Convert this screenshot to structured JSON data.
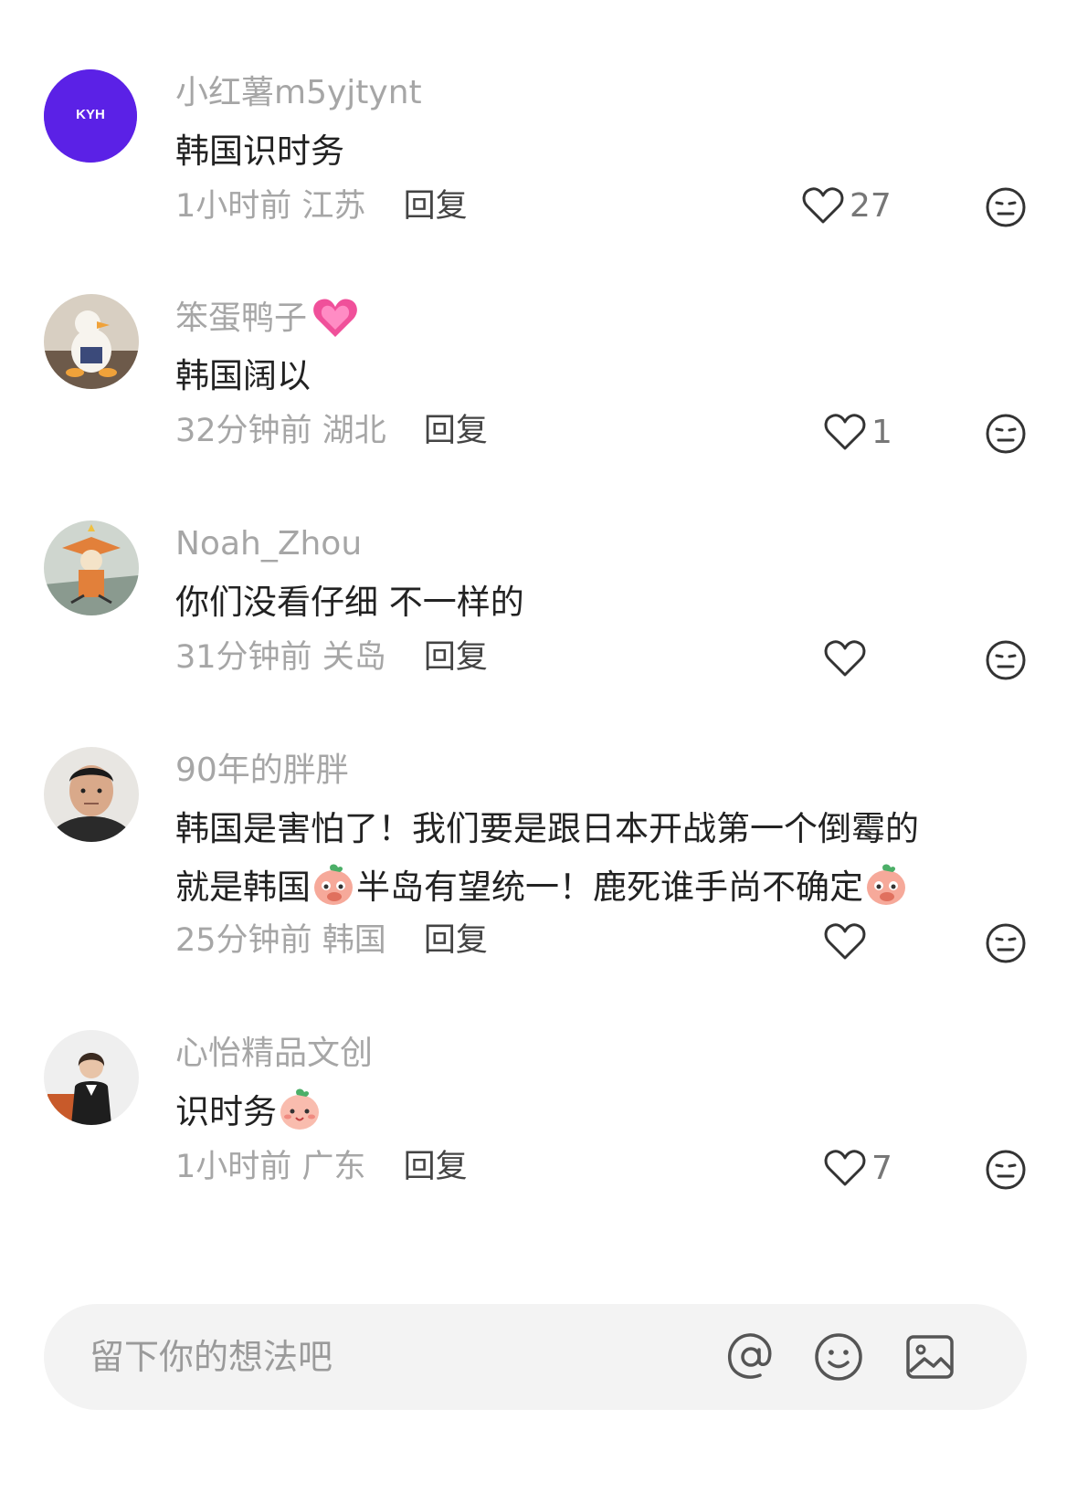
{
  "comments": [
    {
      "username": "小红薯m5yjtynt",
      "avatar_text": "KYH",
      "avatar_color": "#5b21e6",
      "text": "韩国识时务",
      "time": "1小时前",
      "location": "江苏",
      "reply": "回复",
      "likes": "27"
    },
    {
      "username": "笨蛋鸭子",
      "username_emoji": "pink-heart-emoji",
      "text": "韩国阔以",
      "time": "32分钟前",
      "location": "湖北",
      "reply": "回复",
      "likes": "1"
    },
    {
      "username": "Noah_Zhou",
      "text": "你们没看仔细 不一样的",
      "time": "31分钟前",
      "location": "关岛",
      "reply": "回复",
      "likes": ""
    },
    {
      "username": "90年的胖胖",
      "text_line1": "韩国是害怕了！我们要是跟日本开战第一个倒霉的",
      "text_line2_a": "就是韩国",
      "text_line2_b": "半岛有望统一！鹿死谁手尚不确定",
      "inline_emoji": "peach-shy-emoji",
      "time": "25分钟前",
      "location": "韩国",
      "reply": "回复",
      "likes": ""
    },
    {
      "username": "心怡精品文创",
      "text": "识时务",
      "inline_emoji": "peach-smile-emoji",
      "time": "1小时前",
      "location": "广东",
      "reply": "回复",
      "likes": "7"
    }
  ],
  "input": {
    "placeholder": "留下你的想法吧"
  },
  "icons": {
    "like": "heart-outline-icon",
    "dislike": "neutral-face-icon",
    "mention": "at-sign-icon",
    "emoji": "smiley-icon",
    "image": "image-icon"
  }
}
